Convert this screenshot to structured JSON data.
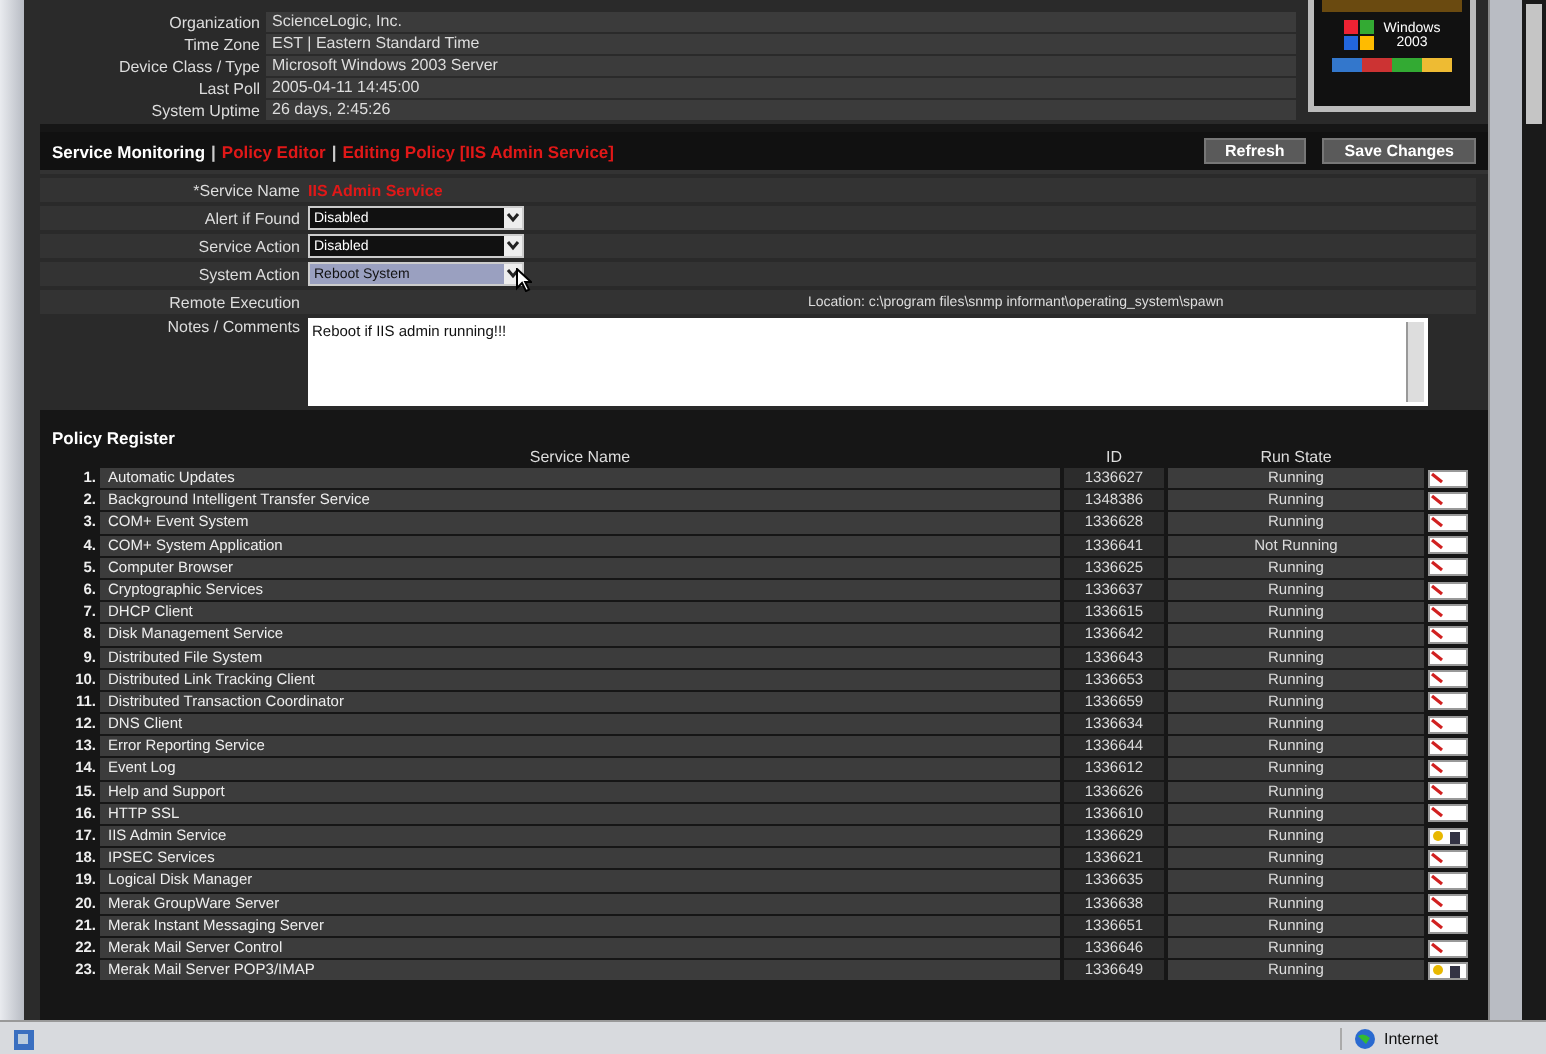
{
  "device_info": [
    {
      "label": "Organization",
      "value": "ScienceLogic, Inc."
    },
    {
      "label": "Time Zone",
      "value": "EST | Eastern Standard Time"
    },
    {
      "label": "Device Class / Type",
      "value": "Microsoft Windows 2003 Server"
    },
    {
      "label": "Last Poll",
      "value": "2005-04-11 14:45:00"
    },
    {
      "label": "System Uptime",
      "value": "26 days, 2:45:26"
    }
  ],
  "badge": {
    "line1": "Windows",
    "line2": "2003"
  },
  "breadcrumb_separator": "|",
  "breadcrumb": [
    {
      "label": "Service Monitoring",
      "kind": "current"
    },
    {
      "label": "Policy Editor",
      "kind": "link"
    },
    {
      "label": "Editing Policy [IIS Admin Service]",
      "kind": "link"
    }
  ],
  "buttons": [
    "Refresh",
    "Save Changes"
  ],
  "form": {
    "service_name_label": "*Service Name",
    "service_name": "IIS Admin Service",
    "selects": [
      {
        "label": "Alert if Found",
        "value": "Disabled",
        "focused": false
      },
      {
        "label": "Service Action",
        "value": "Disabled",
        "focused": false
      },
      {
        "label": "System Action",
        "value": "Reboot System",
        "focused": true
      }
    ],
    "remote_label": "Remote Execution",
    "remote_location": "Location: c:\\program files\\snmp informant\\operating_system\\spawn",
    "notes_label": "Notes / Comments",
    "notes": "Reboot if IIS admin running!!!"
  },
  "policy_register": {
    "title": "Policy Register",
    "columns": [
      "Service Name",
      "ID",
      "Run State"
    ],
    "rows": [
      {
        "n": "1.",
        "name": "Automatic Updates",
        "id": "1336627",
        "state": "Running",
        "kind": "edit"
      },
      {
        "n": "2.",
        "name": "Background Intelligent Transfer Service",
        "id": "1348386",
        "state": "Running",
        "kind": "edit"
      },
      {
        "n": "3.",
        "name": "COM+ Event System",
        "id": "1336628",
        "state": "Running",
        "kind": "edit"
      },
      {
        "n": "4.",
        "name": "COM+ System Application",
        "id": "1336641",
        "state": "Not Running",
        "kind": "edit"
      },
      {
        "n": "5.",
        "name": "Computer Browser",
        "id": "1336625",
        "state": "Running",
        "kind": "edit"
      },
      {
        "n": "6.",
        "name": "Cryptographic Services",
        "id": "1336637",
        "state": "Running",
        "kind": "edit"
      },
      {
        "n": "7.",
        "name": "DHCP Client",
        "id": "1336615",
        "state": "Running",
        "kind": "edit"
      },
      {
        "n": "8.",
        "name": "Disk Management Service",
        "id": "1336642",
        "state": "Running",
        "kind": "edit"
      },
      {
        "n": "9.",
        "name": "Distributed File System",
        "id": "1336643",
        "state": "Running",
        "kind": "edit"
      },
      {
        "n": "10.",
        "name": "Distributed Link Tracking Client",
        "id": "1336653",
        "state": "Running",
        "kind": "edit"
      },
      {
        "n": "11.",
        "name": "Distributed Transaction Coordinator",
        "id": "1336659",
        "state": "Running",
        "kind": "edit"
      },
      {
        "n": "12.",
        "name": "DNS Client",
        "id": "1336634",
        "state": "Running",
        "kind": "edit"
      },
      {
        "n": "13.",
        "name": "Error Reporting Service",
        "id": "1336644",
        "state": "Running",
        "kind": "edit"
      },
      {
        "n": "14.",
        "name": "Event Log",
        "id": "1336612",
        "state": "Running",
        "kind": "edit"
      },
      {
        "n": "15.",
        "name": "Help and Support",
        "id": "1336626",
        "state": "Running",
        "kind": "edit"
      },
      {
        "n": "16.",
        "name": "HTTP SSL",
        "id": "1336610",
        "state": "Running",
        "kind": "edit"
      },
      {
        "n": "17.",
        "name": "IIS Admin Service",
        "id": "1336629",
        "state": "Running",
        "kind": "policy"
      },
      {
        "n": "18.",
        "name": "IPSEC Services",
        "id": "1336621",
        "state": "Running",
        "kind": "edit"
      },
      {
        "n": "19.",
        "name": "Logical Disk Manager",
        "id": "1336635",
        "state": "Running",
        "kind": "edit"
      },
      {
        "n": "20.",
        "name": "Merak GroupWare Server",
        "id": "1336638",
        "state": "Running",
        "kind": "edit"
      },
      {
        "n": "21.",
        "name": "Merak Instant Messaging Server",
        "id": "1336651",
        "state": "Running",
        "kind": "edit"
      },
      {
        "n": "22.",
        "name": "Merak Mail Server Control",
        "id": "1336646",
        "state": "Running",
        "kind": "edit"
      },
      {
        "n": "23.",
        "name": "Merak Mail Server POP3/IMAP",
        "id": "1336649",
        "state": "Running",
        "kind": "policy"
      }
    ]
  },
  "status_bar": {
    "zone": "Internet"
  }
}
